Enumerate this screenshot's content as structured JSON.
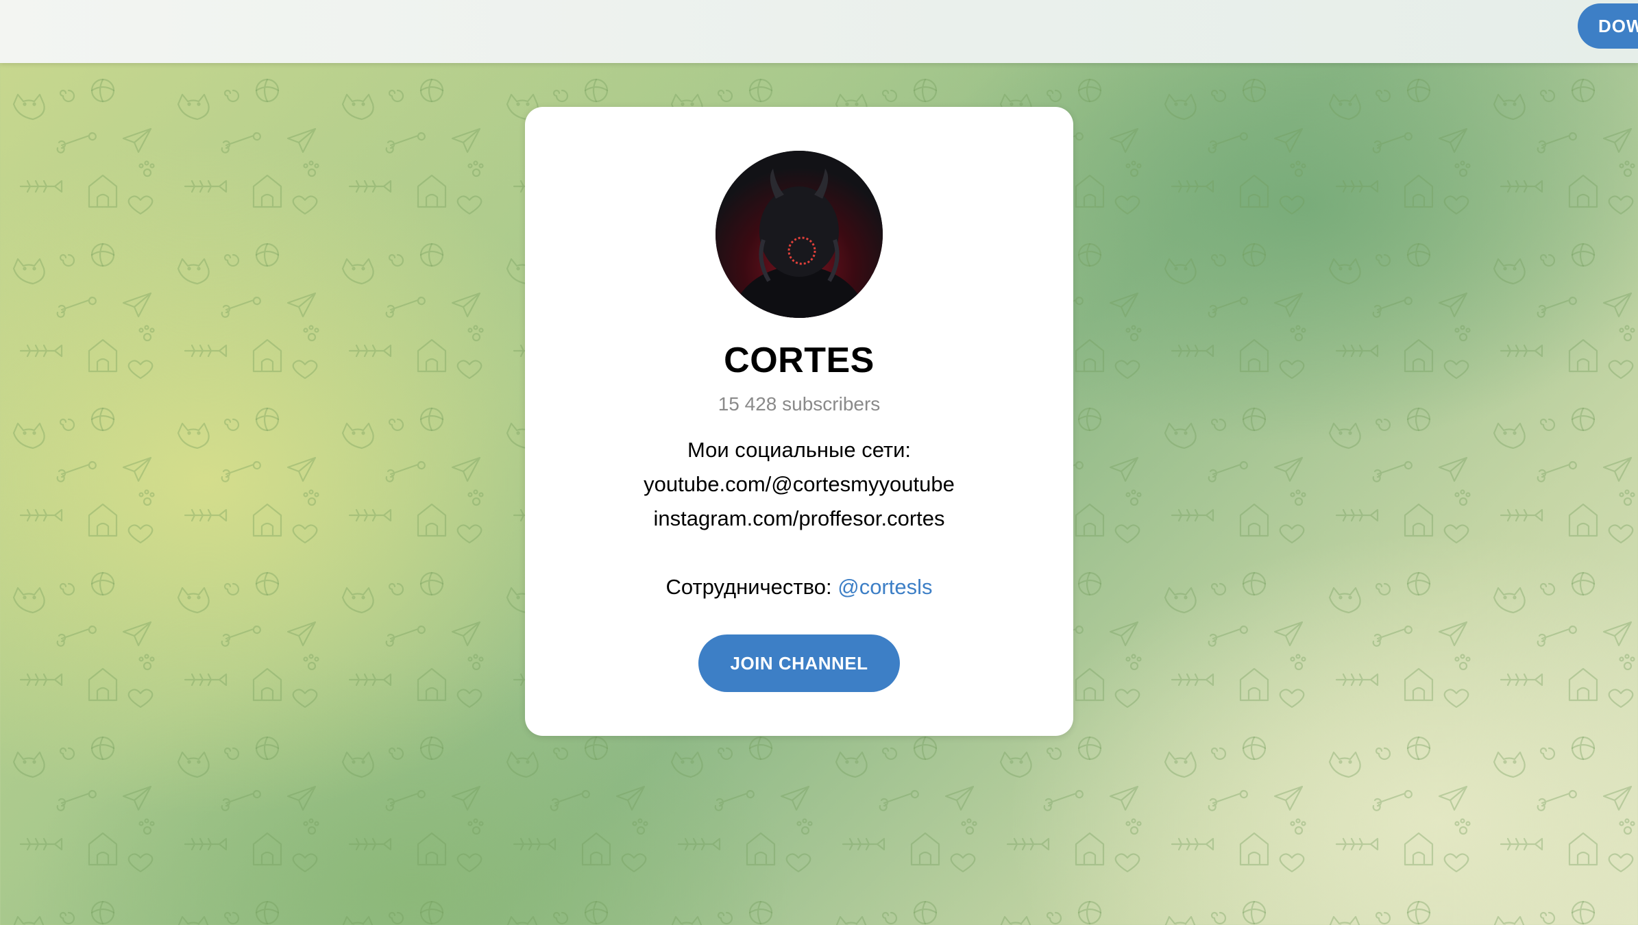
{
  "topbar": {
    "download_label": "DOW"
  },
  "channel": {
    "name": "CORTES",
    "subscribers": "15 428 subscribers",
    "description_lines": [
      "Мои социальные сети:",
      "youtube.com/@cortesmyyoutube",
      "instagram.com/proffesor.cortes"
    ],
    "cooperation_label": "Сотрудничество: ",
    "cooperation_link": "@cortesls",
    "join_label": "JOIN CHANNEL"
  },
  "colors": {
    "accent": "#3d7fc6",
    "subtitle": "#8a8a8a",
    "pattern": "#6f9a58"
  },
  "icons": {
    "avatar": "masked-figure-avatar",
    "background": "doodle-pattern"
  }
}
